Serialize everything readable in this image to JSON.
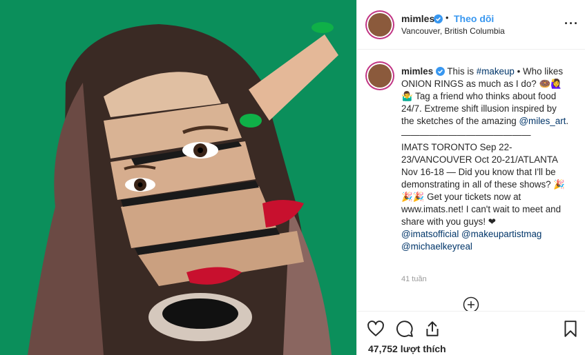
{
  "post": {
    "username": "mimles",
    "dot": "•",
    "follow_label": "Theo dõi",
    "location": "Vancouver, British Columbia",
    "more_label": "···"
  },
  "caption": {
    "username": "mimles",
    "line1_a": "This is ",
    "hashtag": "#makeup",
    "line1_b": " • Who likes ONION RINGS as much as I do? ",
    "emoji1": "🍩🙋‍♀",
    "emoji2": "🤷‍♂",
    "line2": " Tag a friend who thinks about food 24/7. Extreme shift illusion inspired by the sketches of the amazing ",
    "mention_artist": "@miles_art",
    "line2_end": ".",
    "divider": "——————————————",
    "line3": "IMATS TORONTO Sep 22-23/VANCOUVER Oct 20-21/ATLANTA Nov 16-18 — Did you know that I'll be demonstrating in all of these shows? ",
    "emoji3": "🎉🎉🎉",
    "line4": " Get your tickets now at www.imats.net! I can't wait to meet and share with you guys! ❤",
    "mention1": "@imatsofficial",
    "mention2": "@makeupartistmag",
    "mention3": "@michaelkeyreal"
  },
  "timestamp": "41 tuần",
  "likes": "47,752 lượt thích",
  "icons": {
    "verified": "verified-badge-icon",
    "like": "heart-icon",
    "comment": "comment-icon",
    "share": "share-icon",
    "save": "bookmark-icon",
    "load_more": "plus-circle-icon"
  },
  "colors": {
    "link": "#3897f0",
    "mention": "#003569",
    "background_photo": "#0b8f5b",
    "avatar_ring": "#c13584"
  }
}
